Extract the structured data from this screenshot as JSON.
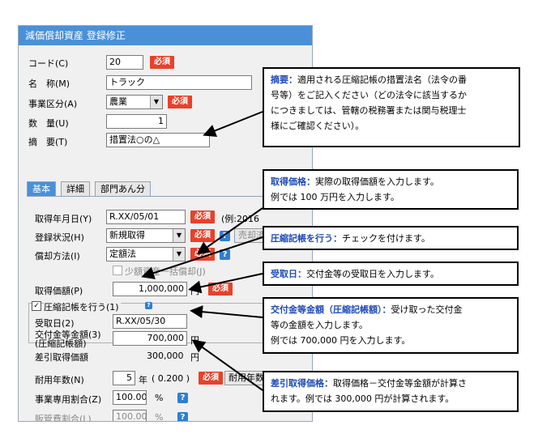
{
  "window": {
    "title": "減価償却資産 登録修正"
  },
  "form": {
    "code_label": "コード(C)",
    "code_value": "20",
    "name_label": "名　称(M)",
    "name_value": "トラック",
    "jigyo_label": "事業区分(A)",
    "jigyo_value": "農業",
    "qty_label": "数　量(U)",
    "qty_value": "1",
    "summary_label": "摘　要(T)",
    "summary_value": "措置法○の△",
    "required": "必須"
  },
  "tabs": [
    {
      "label": "基本"
    },
    {
      "label": "詳細"
    },
    {
      "label": "部門あん分"
    }
  ],
  "basic": {
    "acq_date_label": "取得年月日(Y)",
    "acq_date_value": "R.XX/05/01",
    "acq_date_example": "(例:2016",
    "status_label": "登録状況(H)",
    "status_value": "新規取得",
    "sale_button": "売却済",
    "method_label": "償却方法(I)",
    "method_value": "定額法",
    "small_asset_label": "少額資産一括償却(J)",
    "acq_price_label": "取得価額(P)",
    "acq_price_value": "1,000,000",
    "yen": "円",
    "compression_label": "圧縮記帳を行う(1)",
    "receipt_date_label": "受取日(2)",
    "receipt_date_value": "R.XX/05/30",
    "grant_label_1": "交付金等金額(3)",
    "grant_label_2": "(圧縮記帳額)",
    "grant_value": "700,000",
    "net_label": "差引取得価額",
    "net_value": "300,000",
    "life_label": "耐用年数(N)",
    "life_value": "5",
    "life_unit": "年",
    "life_rate": "( 0.200 )",
    "life_button": "耐用年数",
    "biz_ratio_label": "事業専用割合(Z)",
    "biz_ratio_value": "100.00",
    "pct": "%",
    "sga_label": "販管費割合(L)",
    "sga_value": "100.00"
  },
  "callouts": {
    "summary": {
      "title": "摘要：",
      "lines": [
        "適用される圧縮記帳の措置法名（法令の番",
        "号等）をご記入ください（どの法令に該当するか",
        "につきましては、管轄の税務署または関与税理士",
        "様にご確認ください）。"
      ]
    },
    "acq_price": {
      "title": "取得価格：",
      "lines": [
        "実際の取得価額を入力します。",
        "例では 100 万円を入力します。"
      ]
    },
    "compression": {
      "title": "圧縮記帳を行う：",
      "lines": [
        "チェックを付けます。"
      ]
    },
    "receipt": {
      "title": "受取日：",
      "lines": [
        "交付金等の受取日を入力します。"
      ]
    },
    "grant": {
      "title": "交付金等金額（圧縮記帳額）：",
      "lines": [
        "受け取った交付金",
        "等の金額を入力します。",
        "例では 700,000 円を入力します。"
      ]
    },
    "net": {
      "title": "差引取得価格：",
      "lines": [
        "取得価格－交付金等金額が計算さ",
        "れます。例では 300,000 円が計算されます。"
      ]
    }
  },
  "icons": {
    "help": "?",
    "dropdown": "▼",
    "check": "✓"
  },
  "colors": {
    "title_bar": "#4a90d9",
    "required_badge": "#e8412a",
    "help_icon": "#2e7fd3",
    "callout_title": "#1e4ab8"
  }
}
